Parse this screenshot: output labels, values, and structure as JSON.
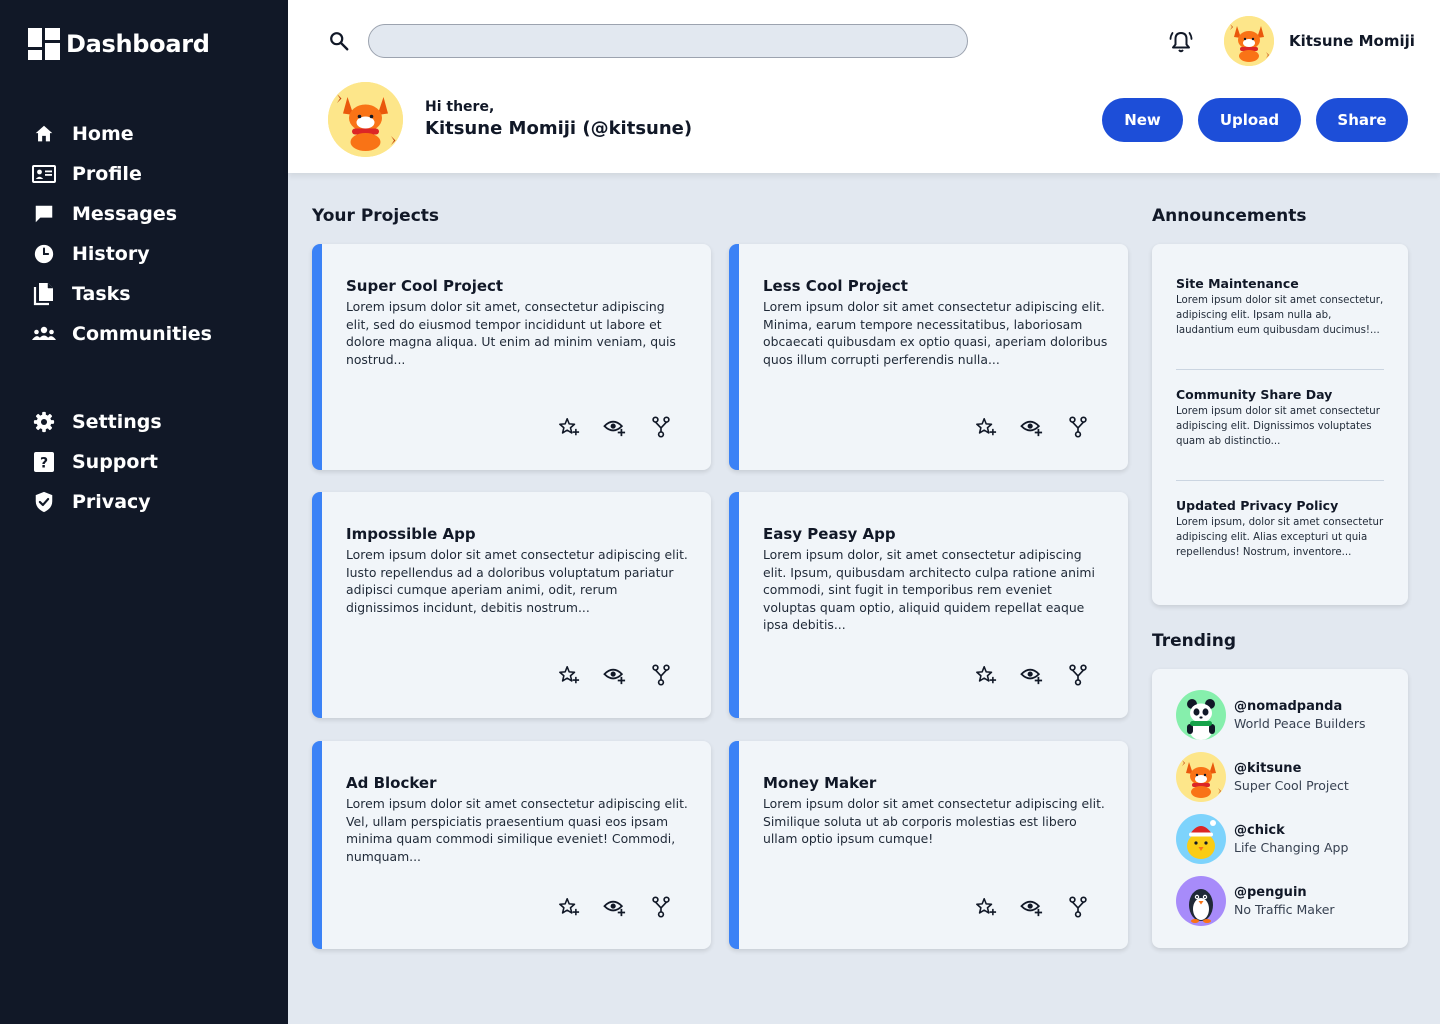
{
  "brand": {
    "title": "Dashboard"
  },
  "sidebar": {
    "main_items": [
      {
        "label": "Home",
        "icon": "home-icon"
      },
      {
        "label": "Profile",
        "icon": "id-card-icon"
      },
      {
        "label": "Messages",
        "icon": "message-icon"
      },
      {
        "label": "History",
        "icon": "clock-icon"
      },
      {
        "label": "Tasks",
        "icon": "documents-icon"
      },
      {
        "label": "Communities",
        "icon": "people-icon"
      }
    ],
    "secondary_items": [
      {
        "label": "Settings",
        "icon": "gear-icon"
      },
      {
        "label": "Support",
        "icon": "help-icon"
      },
      {
        "label": "Privacy",
        "icon": "shield-icon"
      }
    ]
  },
  "header": {
    "search": {
      "placeholder": "",
      "value": ""
    },
    "username": "Kitsune Momiji",
    "greeting": "Hi there,",
    "greeting_name": "Kitsune Momiji (@kitsune)",
    "buttons": {
      "new": "New",
      "upload": "Upload",
      "share": "Share"
    }
  },
  "projects": {
    "title": "Your Projects",
    "items": [
      {
        "title": "Super Cool Project",
        "description": "Lorem ipsum dolor sit amet, consectetur adipiscing elit, sed do eiusmod tempor incididunt ut labore et dolore magna aliqua. Ut enim ad minim veniam, quis nostrud..."
      },
      {
        "title": "Less Cool Project",
        "description": "Lorem ipsum dolor sit amet consectetur adipiscing elit. Minima, earum tempore necessitatibus, laboriosam obcaecati quibusdam ex optio quasi, aperiam doloribus quos illum corrupti perferendis nulla..."
      },
      {
        "title": "Impossible App",
        "description": "Lorem ipsum dolor sit amet consectetur adipiscing elit. Iusto repellendus ad a doloribus voluptatum pariatur adipisci cumque aperiam animi, odit, rerum dignissimos incidunt, debitis nostrum..."
      },
      {
        "title": "Easy Peasy App",
        "description": "Lorem ipsum dolor, sit amet consectetur adipiscing elit. Ipsum, quibusdam architecto culpa ratione animi commodi, sint fugit in temporibus rem eveniet voluptas quam optio, aliquid quidem repellat eaque ipsa debitis..."
      },
      {
        "title": "Ad Blocker",
        "description": "Lorem ipsum dolor sit amet consectetur adipiscing elit. Vel, ullam perspiciatis praesentium quasi eos ipsam minima quam commodi similique eveniet! Commodi, numquam..."
      },
      {
        "title": "Money Maker",
        "description": "Lorem ipsum dolor sit amet consectetur adipiscing elit. Similique soluta ut ab corporis molestias est libero ullam optio ipsum cumque!"
      }
    ]
  },
  "announcements": {
    "title": "Announcements",
    "items": [
      {
        "title": "Site Maintenance",
        "body": "Lorem ipsum dolor sit amet consectetur, adipiscing elit. Ipsam nulla ab, laudantium eum quibusdam ducimus!..."
      },
      {
        "title": "Community Share Day",
        "body": "Lorem ipsum dolor sit amet consectetur adipiscing elit. Dignissimos voluptates quam ab distinctio..."
      },
      {
        "title": "Updated Privacy Policy",
        "body": "Lorem ipsum, dolor sit amet consectetur adipiscing elit. Alias excepturi ut quia repellendus! Nostrum, inventore..."
      }
    ]
  },
  "trending": {
    "title": "Trending",
    "items": [
      {
        "handle": "@nomadpanda",
        "project": "World Peace Builders"
      },
      {
        "handle": "@kitsune",
        "project": "Super Cool Project"
      },
      {
        "handle": "@chick",
        "project": "Life Changing App"
      },
      {
        "handle": "@penguin",
        "project": "No Traffic Maker"
      }
    ]
  },
  "colors": {
    "sidebar_bg": "#111827",
    "accent_blue": "#1d4ed8",
    "card_stripe": "#3b82f6",
    "page_bg": "#e2e8f0"
  }
}
